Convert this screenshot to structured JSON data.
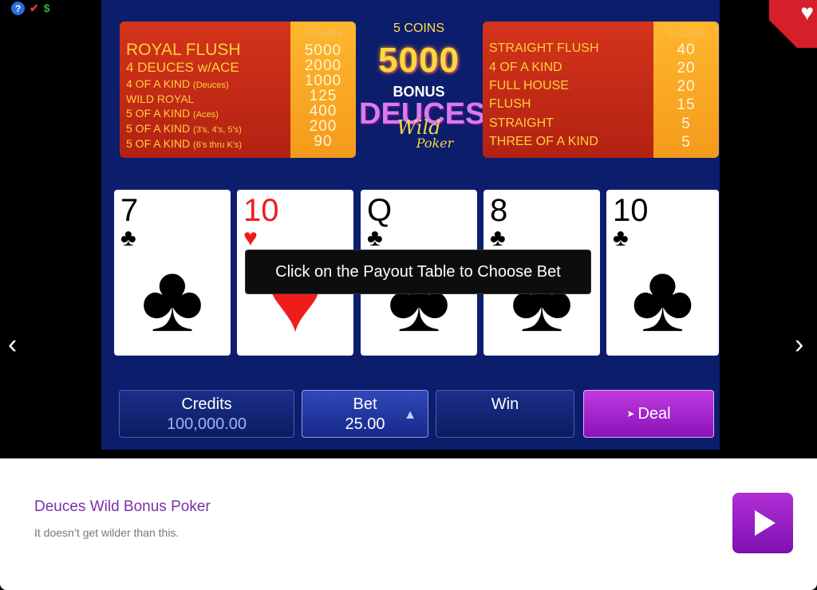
{
  "paytable_left": {
    "coins_header": "5 Coins",
    "rows": [
      {
        "name": "ROYAL FLUSH",
        "sub": "",
        "value": "5000"
      },
      {
        "name": "4 DEUCES w/ACE",
        "sub": "",
        "value": "2000"
      },
      {
        "name": "4 OF A KIND",
        "sub": "(Deuces)",
        "value": "1000"
      },
      {
        "name": "WILD ROYAL",
        "sub": "",
        "value": "125"
      },
      {
        "name": "5 OF A KIND",
        "sub": "(Aces)",
        "value": "400"
      },
      {
        "name": "5 OF A KIND",
        "sub": "(3's, 4's, 5's)",
        "value": "200"
      },
      {
        "name": "5 OF A KIND",
        "sub": "(6's thru K's)",
        "value": "90"
      }
    ]
  },
  "paytable_right": {
    "coins_header": "5 Coins",
    "rows": [
      {
        "name": "STRAIGHT FLUSH",
        "value": "40"
      },
      {
        "name": "4 OF A KIND",
        "value": "20"
      },
      {
        "name": "FULL HOUSE",
        "value": "20"
      },
      {
        "name": "FLUSH",
        "value": "15"
      },
      {
        "name": "STRAIGHT",
        "value": "5"
      },
      {
        "name": "THREE OF A KIND",
        "value": "5"
      }
    ]
  },
  "logo": {
    "coins_label": "5 COINS",
    "top_payout": "5000",
    "bonus": "BONUS",
    "deuces": "DEUCES",
    "wild": "Wild",
    "poker": "Poker"
  },
  "cards": [
    {
      "rank": "7",
      "suit": "♣",
      "color": "#000000"
    },
    {
      "rank": "10",
      "suit": "♥",
      "color": "#ef1c1c"
    },
    {
      "rank": "Q",
      "suit": "♣",
      "color": "#000000"
    },
    {
      "rank": "8",
      "suit": "♣",
      "color": "#000000"
    },
    {
      "rank": "10",
      "suit": "♣",
      "color": "#000000"
    }
  ],
  "tooltip": "Click on the Payout Table to Choose Bet",
  "controls": {
    "credits_label": "Credits",
    "credits_value": "100,000.00",
    "bet_label": "Bet",
    "bet_value": "25.00",
    "bet_arrow": "▲",
    "win_label": "Win",
    "deal_label": "Deal"
  },
  "nav": {
    "left": "‹",
    "right": "›"
  },
  "icons": {
    "help": "?",
    "check": "✔",
    "dollar": "$",
    "heart": "♥"
  },
  "game_info": {
    "title": "Deuces Wild Bonus Poker",
    "description": "It doesn’t get wilder than this."
  },
  "colors": {
    "game_bg": "#0c1d6b",
    "paytable_red": "#c42a16",
    "paytable_orange": "#f7a623",
    "accent_purple": "#9b1fcf",
    "heart_red": "#d61f2b"
  }
}
